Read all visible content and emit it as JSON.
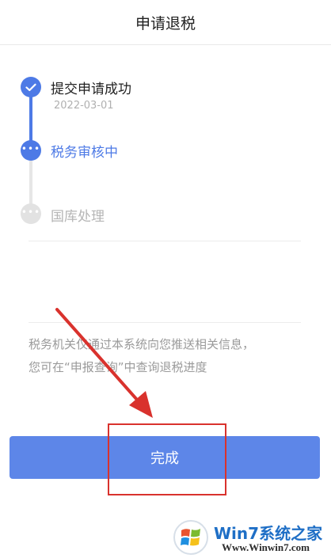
{
  "header": {
    "title": "申请退税"
  },
  "steps": [
    {
      "label": "提交申请成功",
      "date": "2022-03-01",
      "state": "done",
      "icon": "check-icon"
    },
    {
      "label": "税务审核中",
      "state": "active",
      "icon": "more-dots-icon"
    },
    {
      "label": "国库处理",
      "state": "pending",
      "icon": "more-dots-icon"
    }
  ],
  "notice": {
    "line1": "税务机关仅通过本系统向您推送相关信息，",
    "line2": "您可在“申报查询”中查询退税进度"
  },
  "footer": {
    "done_label": "完成"
  },
  "annotation": {
    "color": "#d9322d",
    "shape": "arrow-and-box"
  },
  "watermark": {
    "brand": "Win7系统之家",
    "url": "Www.Winwin7.com"
  },
  "colors": {
    "primary": "#4d7ae6",
    "button": "#5d86e8",
    "pending": "#e2e2e2",
    "notice_text": "#9a9a9a"
  }
}
